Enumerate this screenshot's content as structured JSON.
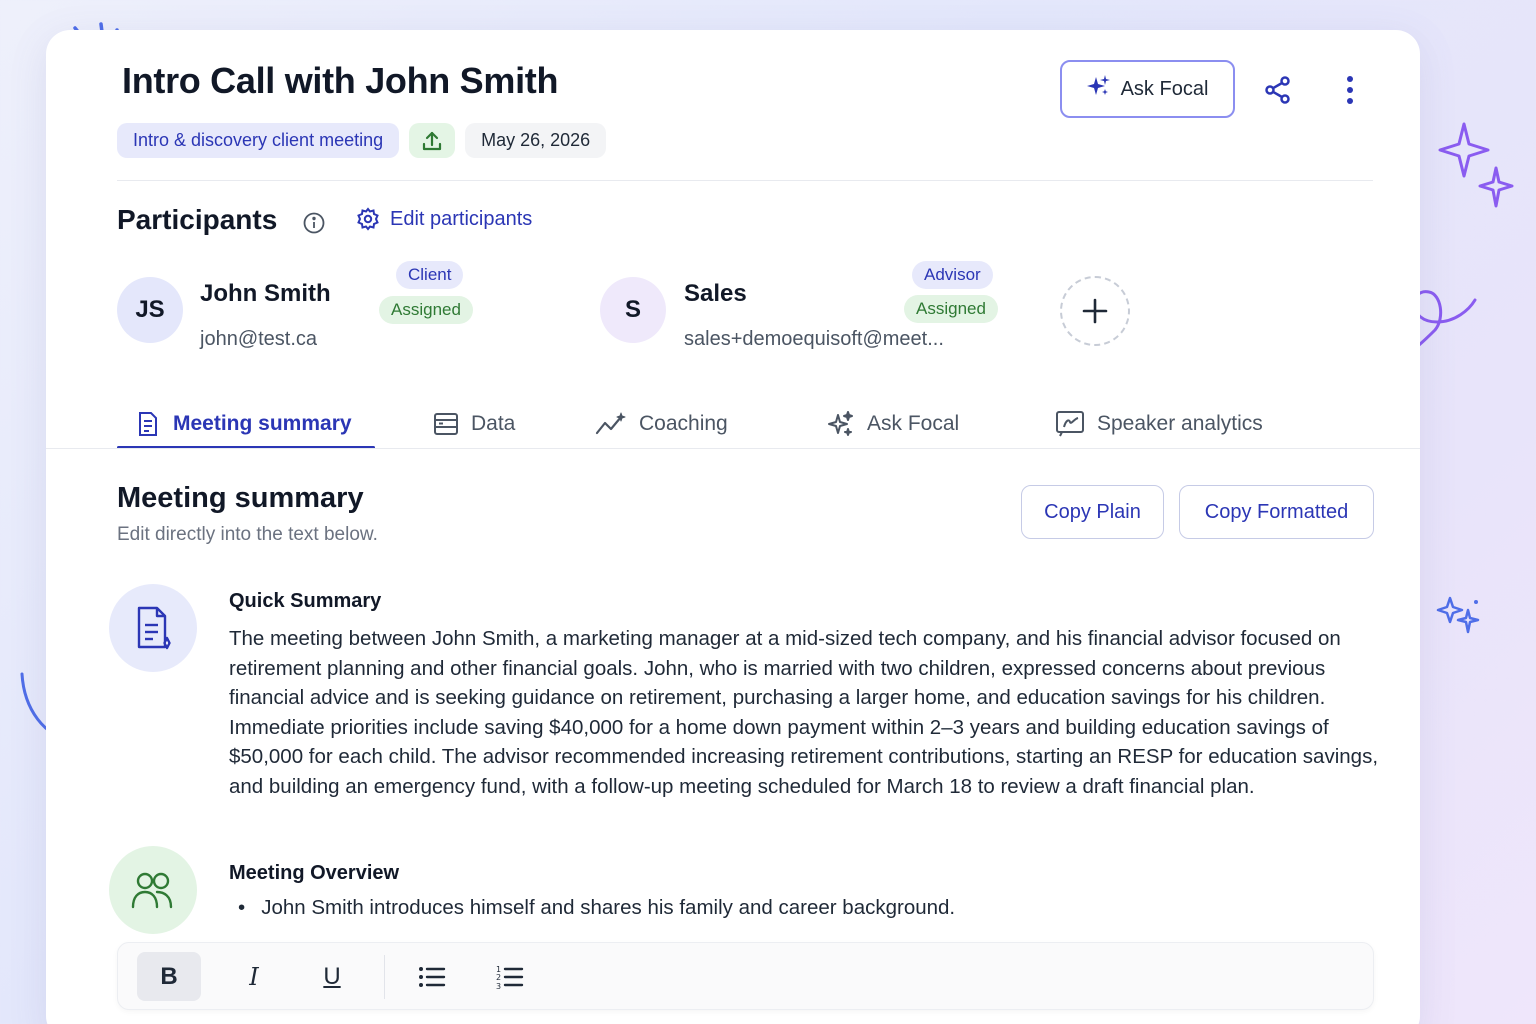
{
  "meeting": {
    "title": "Intro Call with John Smith",
    "type_chip": "Intro & discovery client meeting",
    "date": "May 26, 2026"
  },
  "header": {
    "ask_label": "Ask Focal",
    "share_icon": "share-icon",
    "more_icon": "more-vertical-icon"
  },
  "participants": {
    "heading": "Participants",
    "edit_label": "Edit participants",
    "list": [
      {
        "initials": "JS",
        "name": "John Smith",
        "email": "john@test.ca",
        "role": "Client",
        "status": "Assigned"
      },
      {
        "initials": "S",
        "name": "Sales",
        "email": "sales+demoequisoft@meet...",
        "role": "Advisor",
        "status": "Assigned"
      }
    ]
  },
  "tabs": [
    {
      "label": "Meeting summary",
      "icon": "document-icon",
      "active": true
    },
    {
      "label": "Data",
      "icon": "table-icon",
      "active": false
    },
    {
      "label": "Coaching",
      "icon": "trend-icon",
      "active": false
    },
    {
      "label": "Ask Focal",
      "icon": "sparkle-icon",
      "active": false
    },
    {
      "label": "Speaker analytics",
      "icon": "analytics-icon",
      "active": false
    }
  ],
  "summary": {
    "heading": "Meeting summary",
    "subtitle": "Edit directly into the text below.",
    "copy_plain": "Copy Plain",
    "copy_formatted": "Copy Formatted",
    "quick_title": "Quick Summary",
    "quick_text": "The meeting between John Smith, a marketing manager at a mid-sized tech company, and his financial advisor focused on retirement planning and other financial goals. John, who is married with two children, expressed concerns about previous financial advice and is seeking guidance on retirement, purchasing a larger home, and education savings for his children. Immediate priorities include saving $40,000 for a home down payment within 2–3 years and building education savings of $50,000 for each child. The advisor recommended increasing retirement contributions, starting an RESP for education savings, and building an emergency fund, with a follow-up meeting scheduled for March 18 to review a draft financial plan.",
    "overview_title": "Meeting Overview",
    "overview_items": [
      "John Smith introduces himself and shares his family and career background."
    ]
  },
  "toolbar": {
    "bold": "B",
    "italic": "I",
    "underline": "U"
  },
  "colors": {
    "accent": "#2b36b5",
    "success": "#2f7a34",
    "decor_purple": "#8a5cf0",
    "decor_blue": "#4f6ee8"
  }
}
